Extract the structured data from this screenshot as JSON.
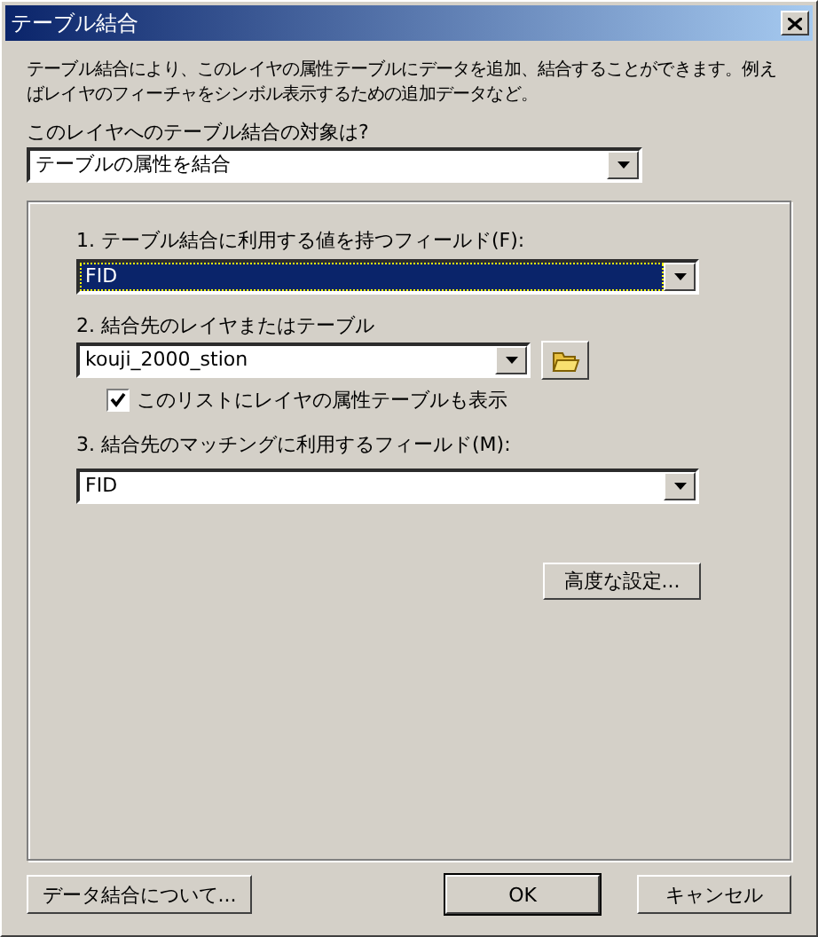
{
  "window": {
    "title": "テーブル結合"
  },
  "intro": "テーブル結合により、このレイヤの属性テーブルにデータを追加、結合することができます。例えばレイヤのフィーチャをシンボル表示するための追加データなど。",
  "target": {
    "label": "このレイヤへのテーブル結合の対象は?",
    "value": "テーブルの属性を結合"
  },
  "join_field": {
    "label": "1.  テーブル結合に利用する値を持つフィールド(F):",
    "value": "FID",
    "selected": true
  },
  "join_table": {
    "label": "2.  結合先のレイヤまたはテーブル",
    "value": "kouji_2000_stion"
  },
  "show_attribute_tables": {
    "label": "このリストにレイヤの属性テーブルも表示",
    "checked": true
  },
  "match_field": {
    "label": "3.  結合先のマッチングに利用するフィールド(M):",
    "value": "FID",
    "selected": false
  },
  "advanced_button": "高度な設定...",
  "buttons": [
    {
      "label": "データ結合について...",
      "default": false
    },
    {
      "label": "OK",
      "default": true
    },
    {
      "label": "キャンセル",
      "default": false
    }
  ]
}
